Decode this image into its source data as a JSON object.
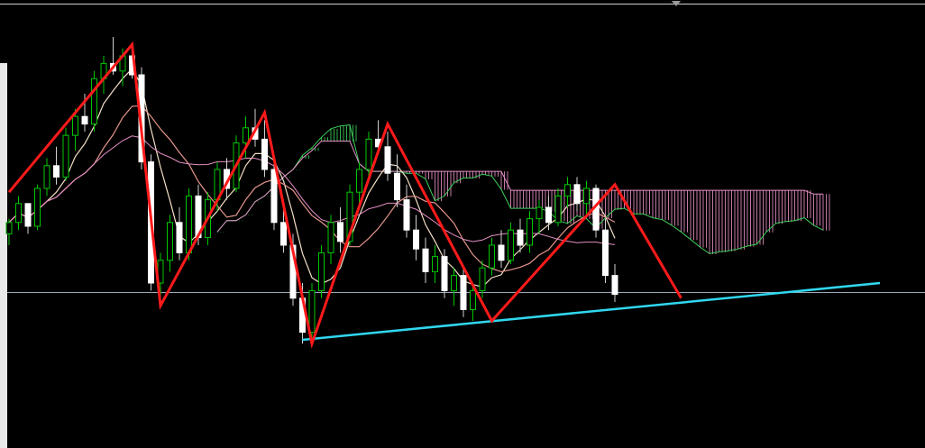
{
  "chart_data": {
    "type": "candlestick",
    "indicators": [
      "ichimoku-cloud",
      "moving-averages",
      "zigzag",
      "trendline",
      "horizontal-level"
    ],
    "price_range": [
      0,
      100
    ],
    "grid": false,
    "colors": {
      "background": "#000000",
      "bull_candle": "#00c800",
      "bear_candle": "#ffffff",
      "wick": "#cfcfcf",
      "cloud_bullish": "#3ccf5a",
      "cloud_bearish": "#e58fc6",
      "ma_fast": "#f4e0c6",
      "ma_slow": "#e5968d",
      "zigzag": "#ff1a1a",
      "trendline": "#30d8f0",
      "level_line": "#9aa8b8"
    },
    "zigzag_pivots": [
      {
        "bar": 0,
        "price": 54
      },
      {
        "bar": 13,
        "price": 93
      },
      {
        "bar": 16,
        "price": 24
      },
      {
        "bar": 27,
        "price": 75
      },
      {
        "bar": 32,
        "price": 14
      },
      {
        "bar": 40,
        "price": 72
      },
      {
        "bar": 51,
        "price": 20
      },
      {
        "bar": 64,
        "price": 56
      },
      {
        "bar": 71,
        "price": 26
      }
    ],
    "trendline": {
      "from": {
        "bar": 31,
        "price": 15
      },
      "to": {
        "bar": 92,
        "price": 30
      }
    },
    "horizontal_level": {
      "price": 27.5
    },
    "candles": [
      {
        "o": 43,
        "h": 47,
        "l": 40,
        "c": 46
      },
      {
        "o": 46,
        "h": 53,
        "l": 44,
        "c": 51
      },
      {
        "o": 51,
        "h": 50,
        "l": 43,
        "c": 45
      },
      {
        "o": 45,
        "h": 56,
        "l": 44,
        "c": 55
      },
      {
        "o": 55,
        "h": 63,
        "l": 53,
        "c": 61
      },
      {
        "o": 61,
        "h": 66,
        "l": 56,
        "c": 58
      },
      {
        "o": 58,
        "h": 71,
        "l": 57,
        "c": 69
      },
      {
        "o": 69,
        "h": 76,
        "l": 65,
        "c": 74
      },
      {
        "o": 74,
        "h": 80,
        "l": 70,
        "c": 72
      },
      {
        "o": 72,
        "h": 86,
        "l": 70,
        "c": 84
      },
      {
        "o": 84,
        "h": 90,
        "l": 80,
        "c": 88
      },
      {
        "o": 88,
        "h": 95,
        "l": 85,
        "c": 86
      },
      {
        "o": 86,
        "h": 92,
        "l": 82,
        "c": 90
      },
      {
        "o": 90,
        "h": 93,
        "l": 84,
        "c": 85
      },
      {
        "o": 85,
        "h": 87,
        "l": 60,
        "c": 62
      },
      {
        "o": 62,
        "h": 64,
        "l": 28,
        "c": 30
      },
      {
        "o": 30,
        "h": 38,
        "l": 24,
        "c": 36
      },
      {
        "o": 36,
        "h": 48,
        "l": 33,
        "c": 46
      },
      {
        "o": 46,
        "h": 50,
        "l": 36,
        "c": 38
      },
      {
        "o": 38,
        "h": 55,
        "l": 36,
        "c": 53
      },
      {
        "o": 53,
        "h": 56,
        "l": 40,
        "c": 42
      },
      {
        "o": 42,
        "h": 54,
        "l": 40,
        "c": 52
      },
      {
        "o": 52,
        "h": 62,
        "l": 49,
        "c": 60
      },
      {
        "o": 60,
        "h": 63,
        "l": 52,
        "c": 55
      },
      {
        "o": 55,
        "h": 69,
        "l": 54,
        "c": 67
      },
      {
        "o": 67,
        "h": 74,
        "l": 63,
        "c": 71
      },
      {
        "o": 71,
        "h": 76,
        "l": 66,
        "c": 68
      },
      {
        "o": 68,
        "h": 73,
        "l": 58,
        "c": 60
      },
      {
        "o": 60,
        "h": 63,
        "l": 44,
        "c": 46
      },
      {
        "o": 46,
        "h": 52,
        "l": 38,
        "c": 40
      },
      {
        "o": 40,
        "h": 43,
        "l": 24,
        "c": 26
      },
      {
        "o": 26,
        "h": 30,
        "l": 14,
        "c": 17
      },
      {
        "o": 17,
        "h": 30,
        "l": 15,
        "c": 28
      },
      {
        "o": 28,
        "h": 40,
        "l": 26,
        "c": 38
      },
      {
        "o": 38,
        "h": 48,
        "l": 35,
        "c": 46
      },
      {
        "o": 46,
        "h": 50,
        "l": 38,
        "c": 41
      },
      {
        "o": 41,
        "h": 56,
        "l": 40,
        "c": 54
      },
      {
        "o": 54,
        "h": 62,
        "l": 51,
        "c": 60
      },
      {
        "o": 60,
        "h": 70,
        "l": 58,
        "c": 68
      },
      {
        "o": 68,
        "h": 73,
        "l": 64,
        "c": 66
      },
      {
        "o": 66,
        "h": 70,
        "l": 57,
        "c": 59
      },
      {
        "o": 59,
        "h": 64,
        "l": 50,
        "c": 52
      },
      {
        "o": 52,
        "h": 56,
        "l": 42,
        "c": 44
      },
      {
        "o": 44,
        "h": 48,
        "l": 36,
        "c": 39
      },
      {
        "o": 39,
        "h": 42,
        "l": 30,
        "c": 33
      },
      {
        "o": 33,
        "h": 40,
        "l": 30,
        "c": 37
      },
      {
        "o": 37,
        "h": 39,
        "l": 26,
        "c": 28
      },
      {
        "o": 28,
        "h": 34,
        "l": 24,
        "c": 32
      },
      {
        "o": 32,
        "h": 34,
        "l": 21,
        "c": 23
      },
      {
        "o": 23,
        "h": 30,
        "l": 20,
        "c": 28
      },
      {
        "o": 28,
        "h": 36,
        "l": 26,
        "c": 34
      },
      {
        "o": 34,
        "h": 42,
        "l": 32,
        "c": 40
      },
      {
        "o": 40,
        "h": 44,
        "l": 34,
        "c": 36
      },
      {
        "o": 36,
        "h": 46,
        "l": 35,
        "c": 44
      },
      {
        "o": 44,
        "h": 47,
        "l": 38,
        "c": 40
      },
      {
        "o": 40,
        "h": 49,
        "l": 38,
        "c": 47
      },
      {
        "o": 47,
        "h": 52,
        "l": 43,
        "c": 50
      },
      {
        "o": 50,
        "h": 53,
        "l": 44,
        "c": 46
      },
      {
        "o": 46,
        "h": 55,
        "l": 45,
        "c": 53
      },
      {
        "o": 53,
        "h": 58,
        "l": 50,
        "c": 56
      },
      {
        "o": 56,
        "h": 58,
        "l": 49,
        "c": 51
      },
      {
        "o": 51,
        "h": 57,
        "l": 48,
        "c": 55
      },
      {
        "o": 55,
        "h": 56,
        "l": 42,
        "c": 44
      },
      {
        "o": 44,
        "h": 47,
        "l": 30,
        "c": 32
      },
      {
        "o": 32,
        "h": 35,
        "l": 25,
        "c": 27
      }
    ]
  }
}
